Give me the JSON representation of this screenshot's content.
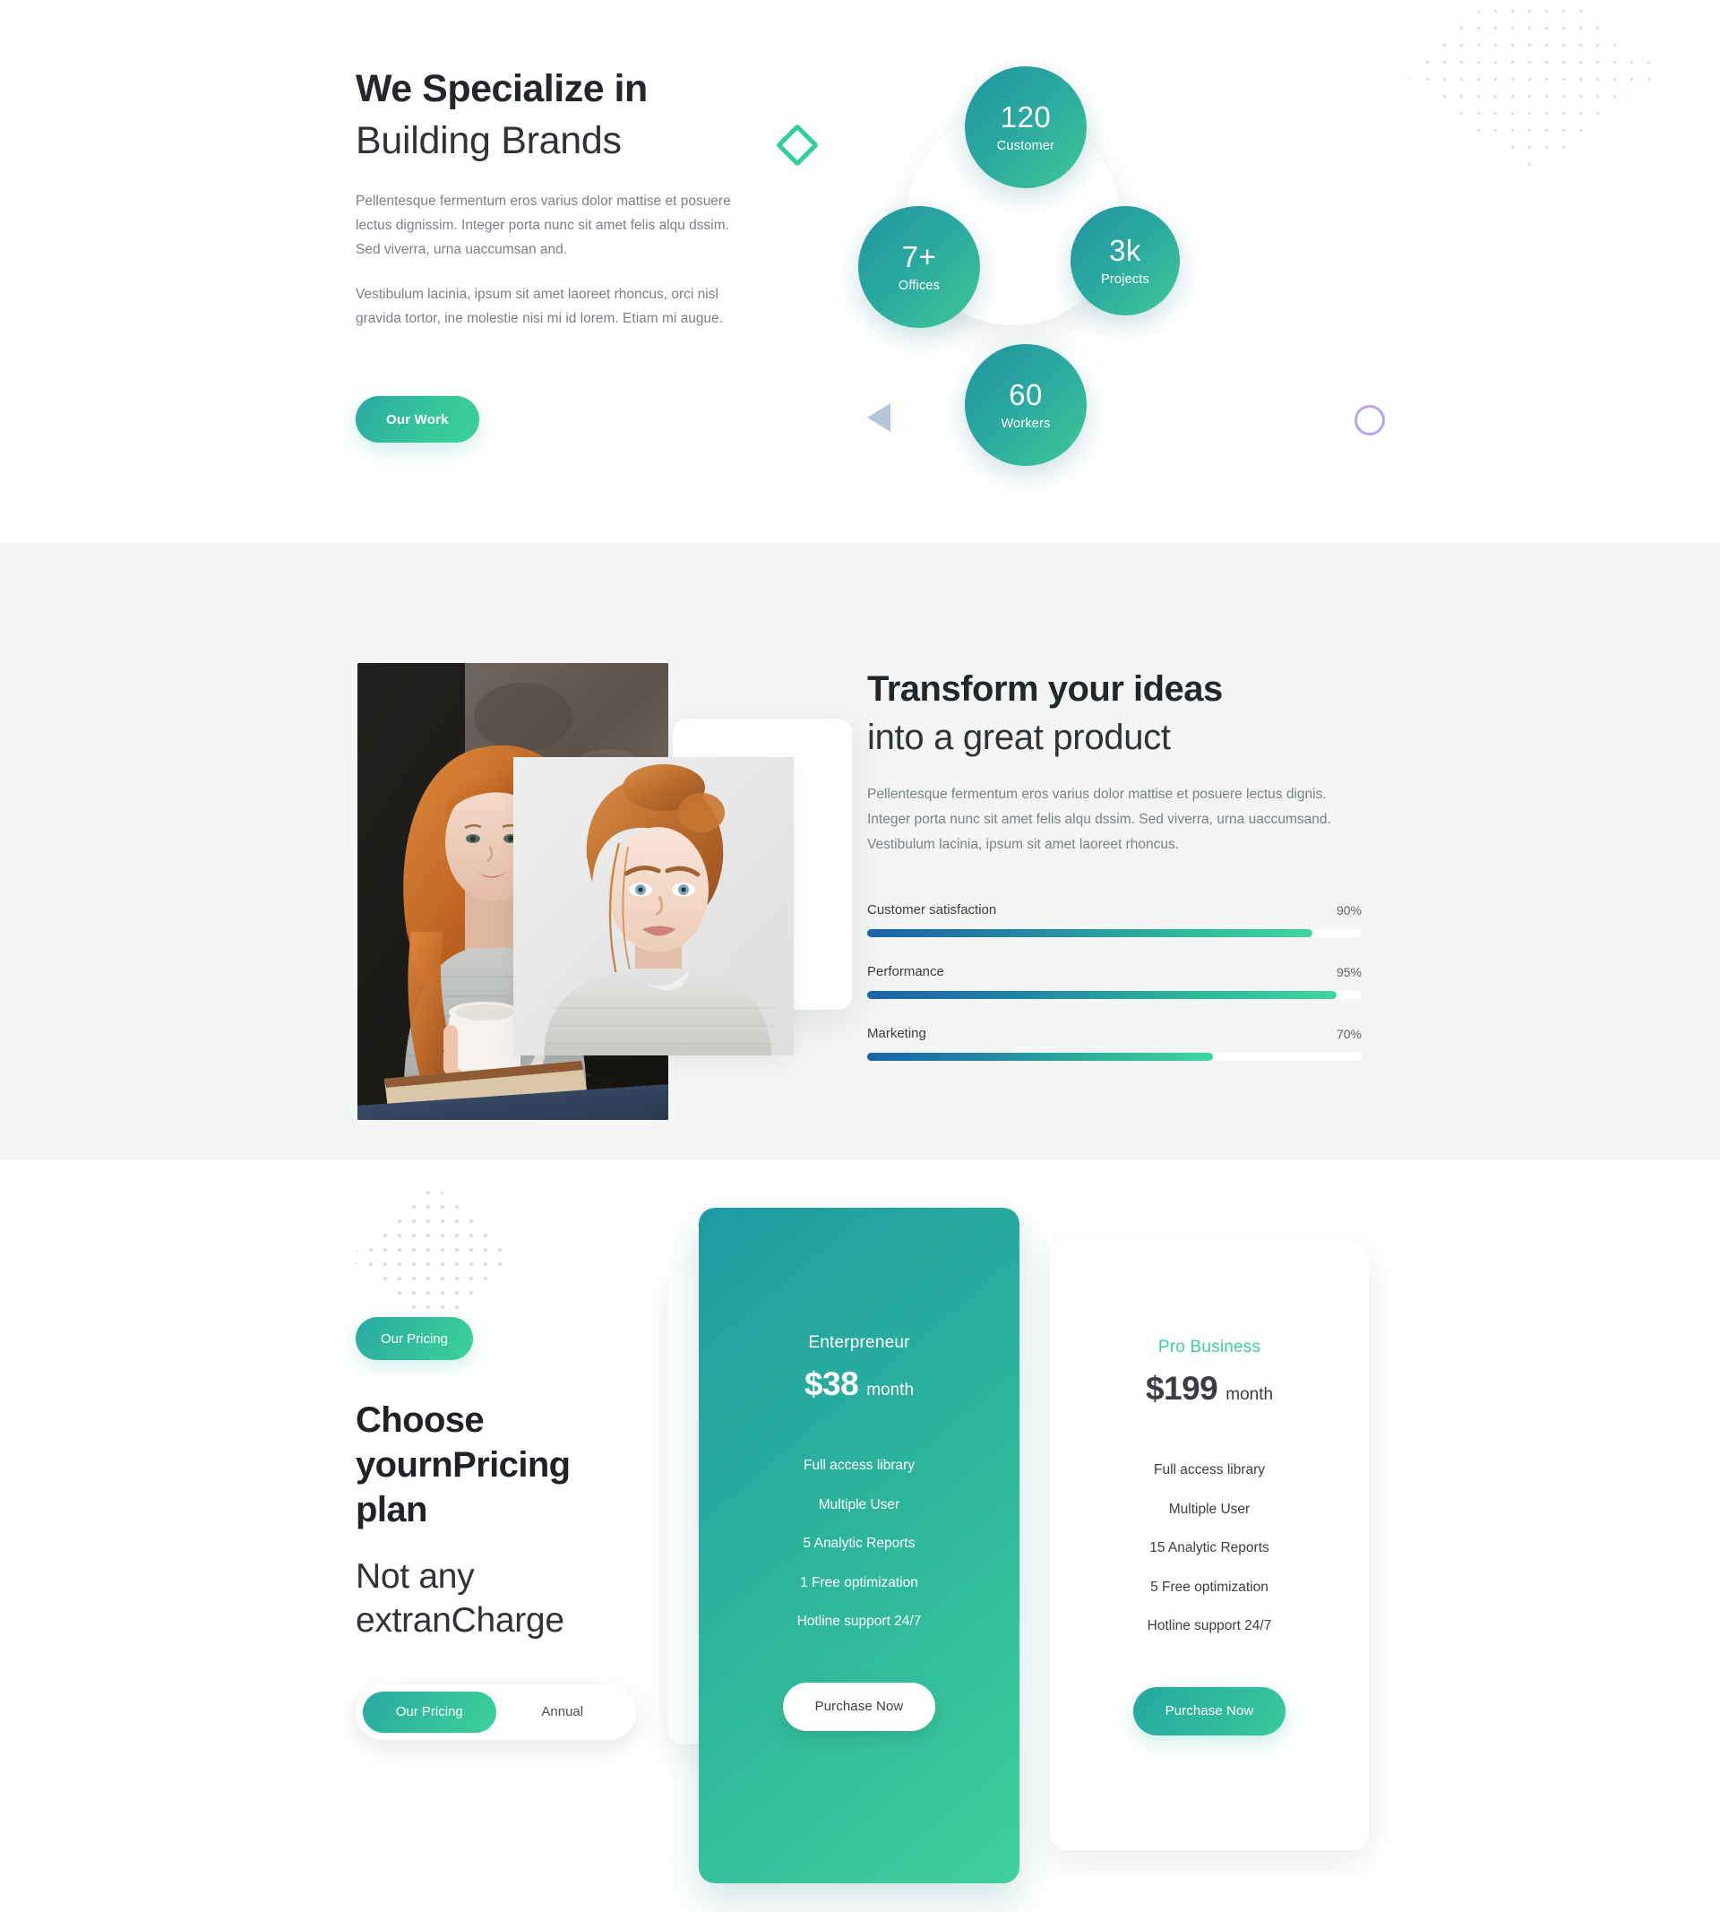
{
  "specialize": {
    "heading_bold": "We Specialize in",
    "heading_light": "Building Brands",
    "paragraph1": "Pellentesque fermentum eros varius dolor mattise et posuere lectus dignissim. Integer porta nunc sit amet felis alqu dssim. Sed viverra, urna uaccumsan and.",
    "paragraph2": "Vestibulum lacinia, ipsum sit amet laoreet rhoncus, orci nisl gravida tortor, ine molestie nisi mi id lorem. Etiam mi augue.",
    "cta_label": "Our Work",
    "stats": [
      {
        "value": "120",
        "label": "Customer"
      },
      {
        "value": "3k",
        "label": "Projects"
      },
      {
        "value": "60",
        "label": "Workers"
      },
      {
        "value": "7+",
        "label": "Offices"
      }
    ],
    "decorations": {
      "diamond_color": "#2ecf9b",
      "triangle_color": "#b4c6d8",
      "circle_outline_color": "#b9a4ea",
      "dot_pattern_color": "#dcdcde"
    }
  },
  "transform": {
    "heading_bold": "Transform your ideas",
    "heading_light": "into a great product",
    "paragraph": "Pellentesque fermentum eros varius dolor mattise et posuere lectus dignis. Integer porta nunc sit amet felis alqu dssim. Sed viverra, urna uaccumsand. Vestibulum lacinia, ipsum sit amet laoreet rhoncus.",
    "chart_data": {
      "type": "bar",
      "title": "",
      "categories": [
        "Customer satisfaction",
        "Performance",
        "Marketing"
      ],
      "values": [
        90,
        95,
        70
      ],
      "value_labels": [
        "90%",
        "95%",
        "70%"
      ],
      "xlabel": "",
      "ylabel": "",
      "ylim": [
        0,
        100
      ],
      "orientation": "horizontal",
      "grid": false,
      "legend": false,
      "fill_gradient": [
        "#1a63a8",
        "#2387a5",
        "#2eb79a",
        "#3ed6a0"
      ],
      "track_color": "#ffffff"
    }
  },
  "pricing": {
    "badge_label": "Our Pricing",
    "heading_bold": "Choose yournPricing plan",
    "heading_light": "Not any extranCharge",
    "toggle": {
      "options": [
        "Our Pricing",
        "Annual"
      ],
      "selected": "Our Pricing"
    },
    "plans": [
      {
        "name": "Enterpreneur",
        "price": "$38",
        "period": "month",
        "featured": true,
        "features": [
          "Full access library",
          "Multiple User",
          "5 Analytic Reports",
          "1 Free optimization",
          "Hotline support 24/7"
        ],
        "cta_label": "Purchase Now"
      },
      {
        "name": "Pro Business",
        "price": "$199",
        "period": "month",
        "featured": false,
        "features": [
          "Full access library",
          "Multiple User",
          "15 Analytic Reports",
          "5 Free optimization",
          "Hotline support 24/7"
        ],
        "cta_label": "Purchase Now"
      }
    ]
  },
  "theme": {
    "accent_teal": "#2aa8a3",
    "accent_green": "#3cd19b",
    "heading_dark": "#23262b",
    "body_gray": "#7b7f86",
    "section_bg": "#f4f5f5"
  }
}
